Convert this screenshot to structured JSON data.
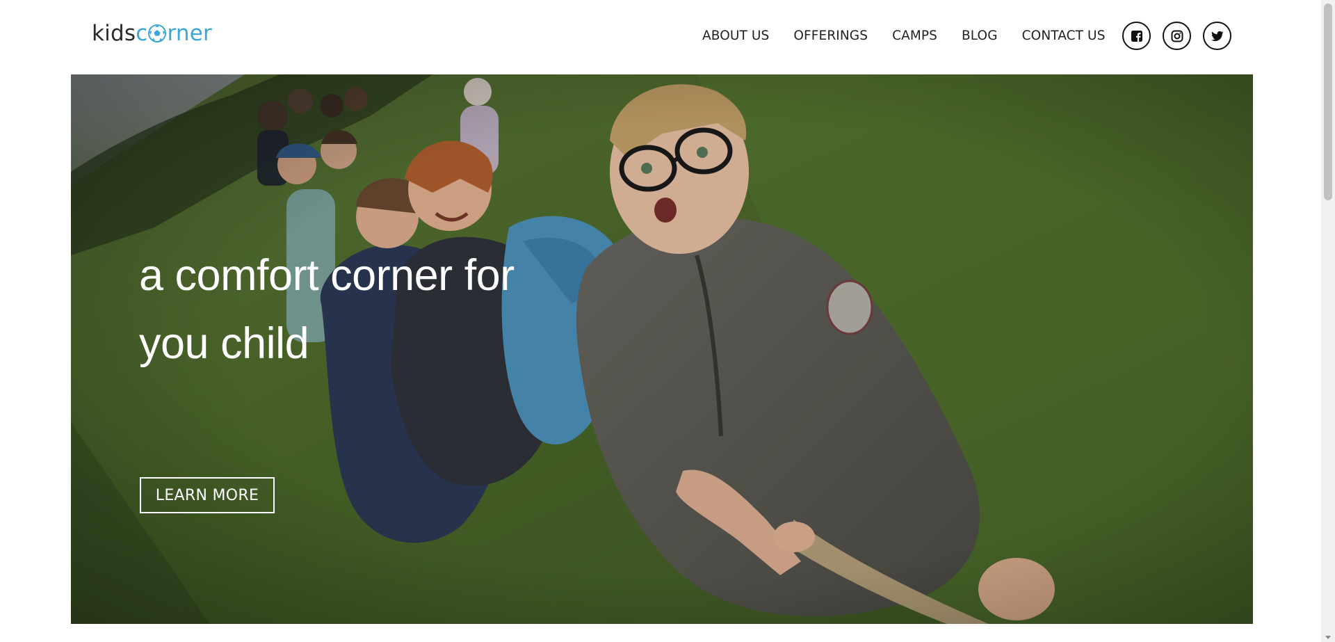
{
  "header": {
    "logo": {
      "part1": "kids",
      "part2": "rner",
      "ball_icon": "soccer-ball-icon",
      "accent_color": "#3aa7d8"
    },
    "nav": [
      {
        "label": "ABOUT US"
      },
      {
        "label": "OFFERINGS"
      },
      {
        "label": "CAMPS"
      },
      {
        "label": "BLOG"
      },
      {
        "label": "CONTACT US"
      }
    ],
    "social": [
      {
        "icon": "facebook-icon"
      },
      {
        "icon": "instagram-icon"
      },
      {
        "icon": "twitter-icon"
      }
    ]
  },
  "hero": {
    "title": "a comfort corner for you child",
    "cta_label": "LEARN MORE",
    "image": "children-tug-of-war-photo"
  }
}
